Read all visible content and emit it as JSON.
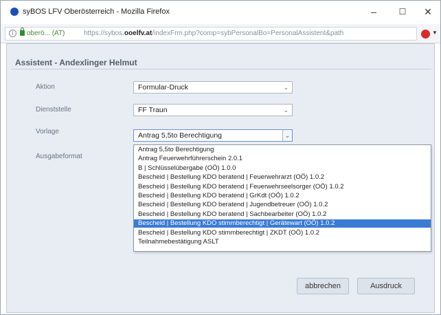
{
  "window": {
    "title": "syBOS LFV Oberösterreich - Mozilla Firefox",
    "minimize": "–",
    "maximize": "☐",
    "close": "✕"
  },
  "urlbar": {
    "identity": "oberö... (AT)",
    "url_prefix": "https://sybos.",
    "url_domain": "ooelfv.at",
    "url_suffix": "/indexFrm.php?comp=sybPersonalBo=PersonalAssistent&path"
  },
  "dialog": {
    "title": "Assistent - Andexlinger Helmut",
    "fields": [
      {
        "label": "Aktion",
        "value": "Formular-Druck"
      },
      {
        "label": "Dienststelle",
        "value": "FF Traun"
      },
      {
        "label": "Vorlage",
        "value": "Antrag 5,5to Berechtigung"
      },
      {
        "label": "Ausgabeformat",
        "value": ""
      }
    ],
    "dropdown_options": [
      "Antrag 5,5to Berechtigung",
      "Antrag Feuerwehrführerschein 2.0.1",
      "B | Schlüsselübergabe (OÖ) 1.0.0",
      "Bescheid | Bestellung KDO beratend | Feuerwehrarzt (OÖ) 1.0.2",
      "Bescheid | Bestellung KDO beratend | Feuerwehrseelsorger (OÖ) 1.0.2",
      "Bescheid | Bestellung KDO beratend | GrKdt (OÖ) 1.0.2",
      "Bescheid | Bestellung KDO beratend | Jugendbetreuer (OÖ) 1.0.2",
      "Bescheid | Bestellung KDO beratend | Sachbearbeiter (OÖ) 1.0.2",
      "Bescheid | Bestellung KDO stimmberechtigt | Gerätewart (OÖ) 1.0.2",
      "Bescheid | Bestellung KDO stimmberechtigt | ZKDT (OÖ) 1.0.2",
      "Teilnahmebestätigung ASLT"
    ],
    "highlighted_index": 8,
    "buttons": {
      "cancel": "abbrechen",
      "print": "Ausdruck"
    }
  },
  "colors": {
    "highlight": "#3a7bd5",
    "dialog_bg": "#e8edf4"
  }
}
